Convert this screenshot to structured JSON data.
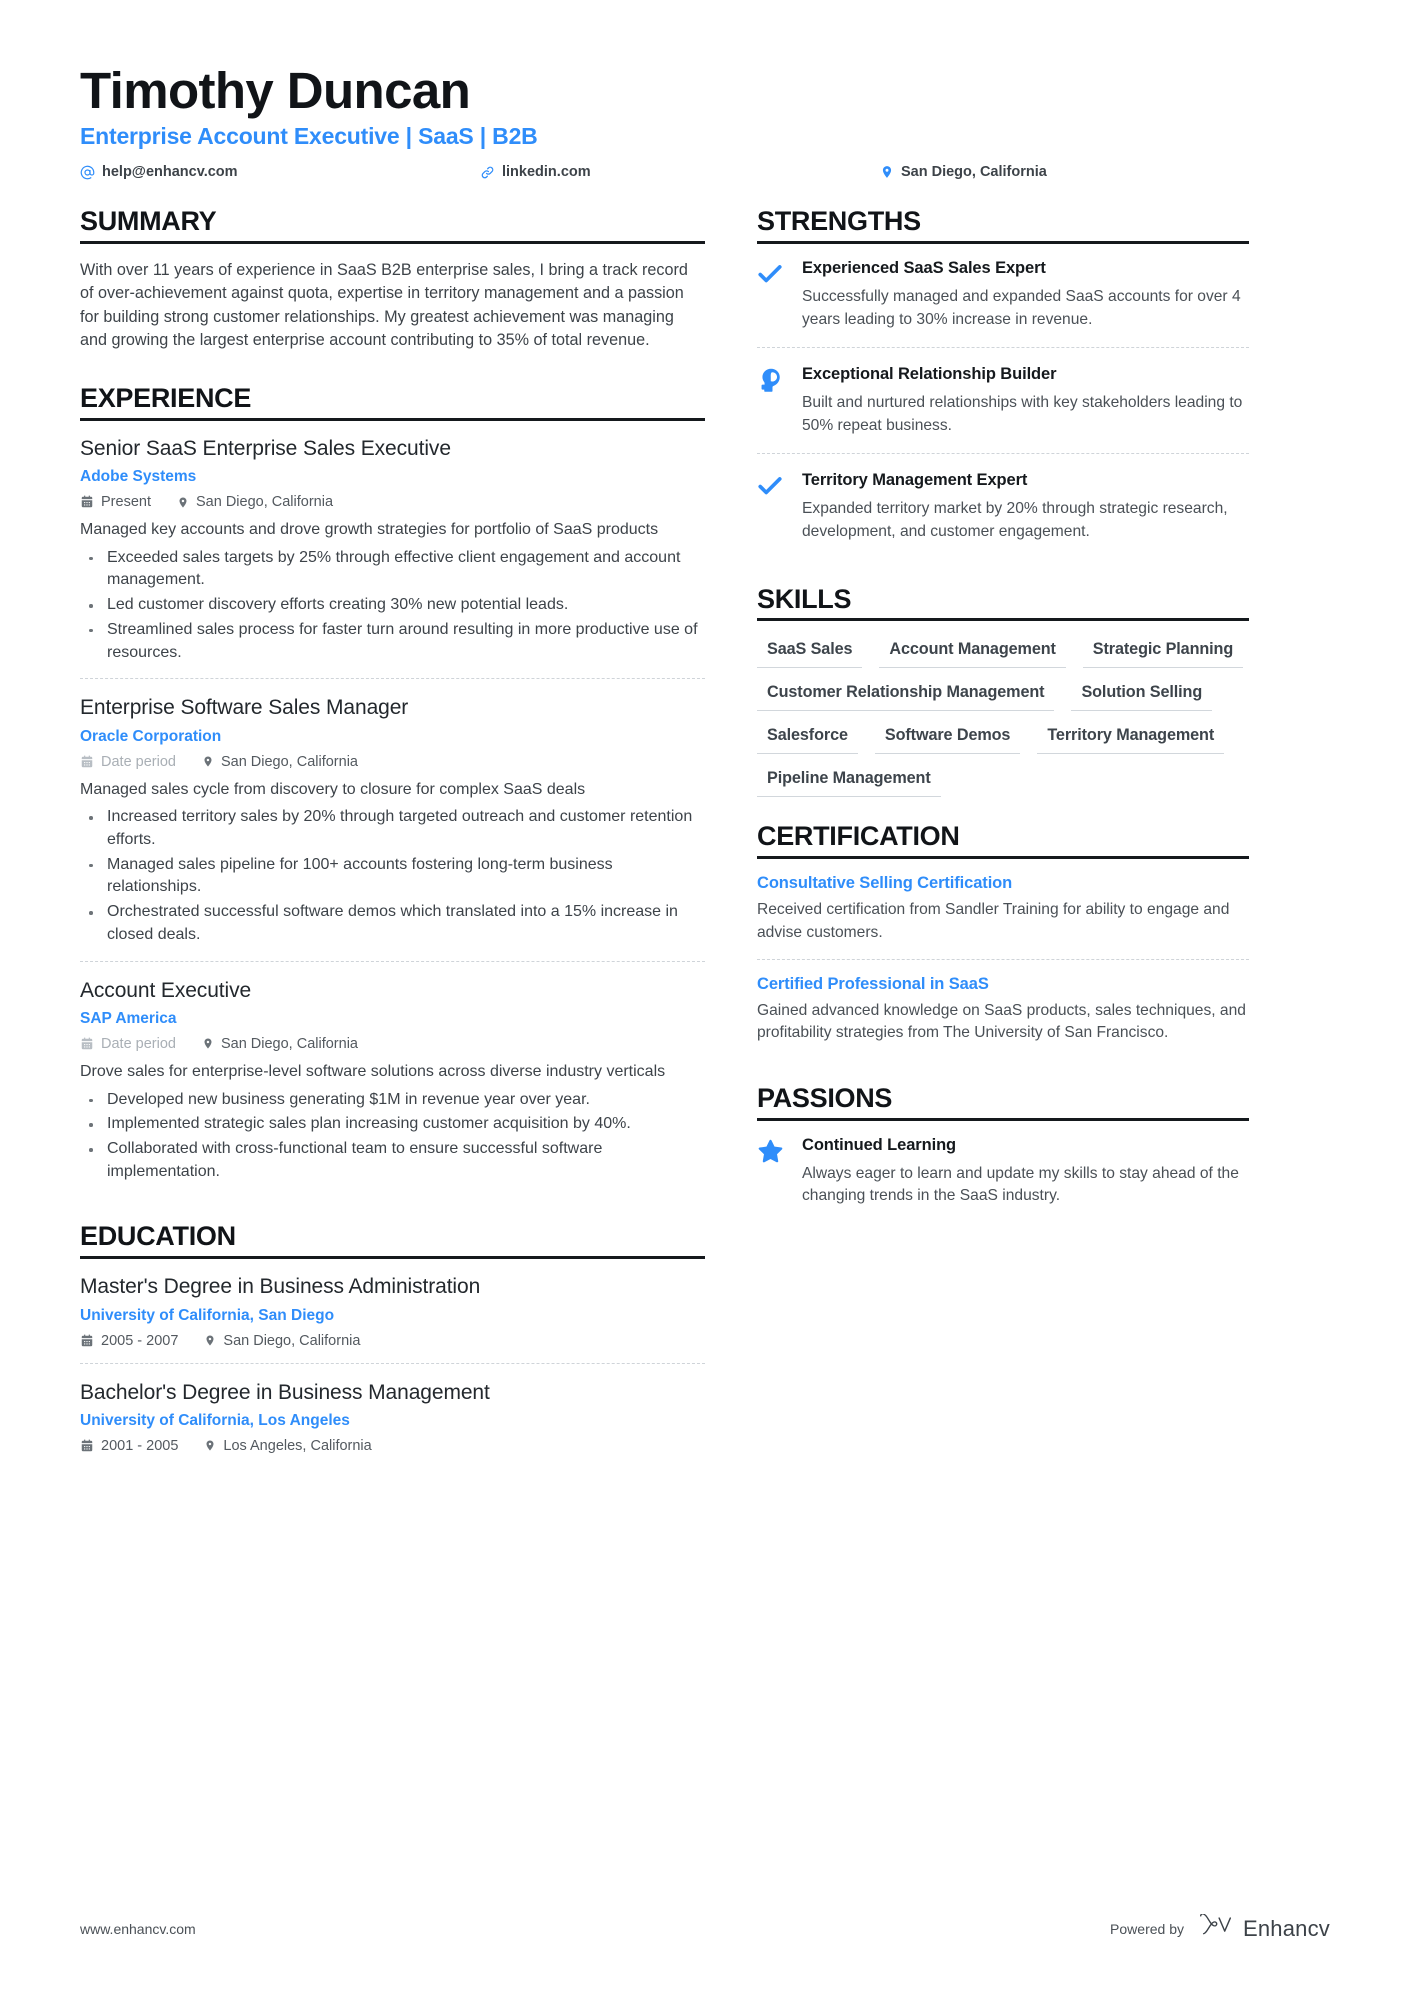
{
  "header": {
    "name": "Timothy Duncan",
    "job_title": "Enterprise Account Executive | SaaS | B2B",
    "contacts": [
      {
        "icon": "at-icon",
        "label": "help@enhancv.com"
      },
      {
        "icon": "link-icon",
        "label": "linkedin.com"
      },
      {
        "icon": "location-pin-icon",
        "label": "San Diego, California"
      }
    ]
  },
  "accent_color": "#2f8dfa",
  "summary": {
    "heading": "SUMMARY",
    "text": "With over 11 years of experience in SaaS B2B enterprise sales, I bring a track record of over-achievement against quota, expertise in territory management and a passion for building strong customer relationships. My greatest achievement was managing and growing the largest enterprise account contributing to 35% of total revenue."
  },
  "experience": {
    "heading": "EXPERIENCE",
    "entries": [
      {
        "title": "Senior SaaS Enterprise Sales Executive",
        "organization": "Adobe Systems",
        "date": "Present",
        "date_muted": false,
        "location": "San Diego, California",
        "description": "Managed key accounts and drove growth strategies for portfolio of SaaS products",
        "bullets": [
          "Exceeded sales targets by 25% through effective client engagement and account management.",
          "Led customer discovery efforts creating 30% new potential leads.",
          "Streamlined sales process for faster turn around resulting in more productive use of resources."
        ]
      },
      {
        "title": "Enterprise Software Sales Manager",
        "organization": "Oracle Corporation",
        "date": "Date period",
        "date_muted": true,
        "location": "San Diego, California",
        "description": "Managed sales cycle from discovery to closure for complex SaaS deals",
        "bullets": [
          "Increased territory sales by 20% through targeted outreach and customer retention efforts.",
          "Managed sales pipeline for 100+ accounts fostering long-term business relationships.",
          "Orchestrated successful software demos which translated into a 15% increase in closed deals."
        ]
      },
      {
        "title": "Account Executive",
        "organization": "SAP America",
        "date": "Date period",
        "date_muted": true,
        "location": "San Diego, California",
        "description": "Drove sales for enterprise-level software solutions across diverse industry verticals",
        "bullets": [
          "Developed new business generating $1M in revenue year over year.",
          "Implemented strategic sales plan increasing customer acquisition by 40%.",
          "Collaborated with cross-functional team to ensure successful software implementation."
        ]
      }
    ]
  },
  "education": {
    "heading": "EDUCATION",
    "entries": [
      {
        "degree": "Master's Degree in Business Administration",
        "school": "University of California, San Diego",
        "date": "2005 - 2007",
        "location": "San Diego, California"
      },
      {
        "degree": "Bachelor's Degree in Business Management",
        "school": "University of California, Los Angeles",
        "date": "2001 - 2005",
        "location": "Los Angeles, California"
      }
    ]
  },
  "strengths": {
    "heading": "STRENGTHS",
    "items": [
      {
        "icon": "check-icon",
        "name": "Experienced SaaS Sales Expert",
        "description": "Successfully managed and expanded SaaS accounts for over 4 years leading to 30% increase in revenue."
      },
      {
        "icon": "head-brain-icon",
        "name": "Exceptional Relationship Builder",
        "description": "Built and nurtured relationships with key stakeholders leading to 50% repeat business."
      },
      {
        "icon": "check-icon",
        "name": "Territory Management Expert",
        "description": "Expanded territory market by 20% through strategic research, development, and customer engagement."
      }
    ]
  },
  "skills": {
    "heading": "SKILLS",
    "rows": [
      [
        "SaaS Sales",
        "Account Management"
      ],
      [
        "Strategic Planning"
      ],
      [
        "Customer Relationship Management"
      ],
      [
        "Solution Selling",
        "Salesforce"
      ],
      [
        "Software Demos"
      ],
      [
        "Territory Management"
      ],
      [
        "Pipeline Management"
      ]
    ]
  },
  "certification": {
    "heading": "CERTIFICATION",
    "items": [
      {
        "title": "Consultative Selling Certification",
        "description": "Received certification from Sandler Training for ability to engage and advise customers."
      },
      {
        "title": "Certified Professional in SaaS",
        "description": "Gained advanced knowledge on SaaS products, sales techniques, and profitability strategies from The University of San Francisco."
      }
    ]
  },
  "passions": {
    "heading": "PASSIONS",
    "items": [
      {
        "icon": "star-icon",
        "name": "Continued Learning",
        "description": "Always eager to learn and update my skills to stay ahead of the changing trends in the SaaS industry."
      }
    ]
  },
  "footer": {
    "url": "www.enhancv.com",
    "powered_by": "Powered by",
    "brand": "Enhancv"
  }
}
